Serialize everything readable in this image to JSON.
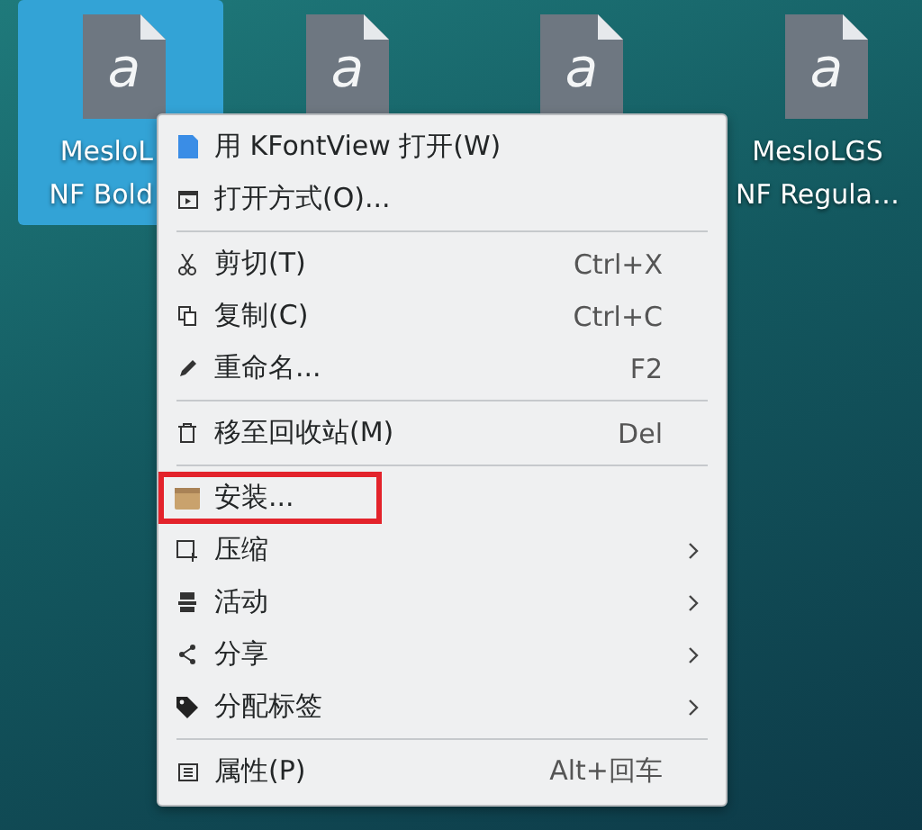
{
  "desktop_icons": [
    {
      "glyph": "a",
      "label_lines": [
        "MesloL",
        "NF Bold"
      ],
      "selected": true
    },
    {
      "glyph": "a",
      "selected": false
    },
    {
      "glyph": "a",
      "selected": false
    },
    {
      "glyph": "a",
      "label_lines": [
        "MesloLGS",
        "NF Regula…"
      ],
      "selected": false
    }
  ],
  "context_menu": {
    "items": [
      {
        "kind": "item",
        "label": "用 KFontView 打开(W)",
        "highlighted": false,
        "has_submenu": false
      },
      {
        "kind": "item",
        "label": "打开方式(O)...",
        "highlighted": false,
        "has_submenu": false
      },
      {
        "kind": "separator"
      },
      {
        "kind": "item",
        "label": "剪切(T)",
        "shortcut": "Ctrl+X",
        "highlighted": false,
        "has_submenu": false
      },
      {
        "kind": "item",
        "label": "复制(C)",
        "shortcut": "Ctrl+C",
        "highlighted": false,
        "has_submenu": false
      },
      {
        "kind": "item",
        "label": "重命名...",
        "shortcut": "F2",
        "highlighted": false,
        "has_submenu": false
      },
      {
        "kind": "separator"
      },
      {
        "kind": "item",
        "label": "移至回收站(M)",
        "shortcut": "Del",
        "highlighted": false,
        "has_submenu": false
      },
      {
        "kind": "separator"
      },
      {
        "kind": "item",
        "label": "安装...",
        "highlighted": true,
        "has_submenu": false
      },
      {
        "kind": "item",
        "label": "压缩",
        "highlighted": false,
        "has_submenu": true
      },
      {
        "kind": "item",
        "label": "活动",
        "highlighted": false,
        "has_submenu": true
      },
      {
        "kind": "item",
        "label": "分享",
        "highlighted": false,
        "has_submenu": true
      },
      {
        "kind": "item",
        "label": "分配标签",
        "highlighted": false,
        "has_submenu": true
      },
      {
        "kind": "separator"
      },
      {
        "kind": "item",
        "label": "属性(P)",
        "shortcut": "Alt+回车",
        "highlighted": false,
        "has_submenu": false
      }
    ]
  }
}
